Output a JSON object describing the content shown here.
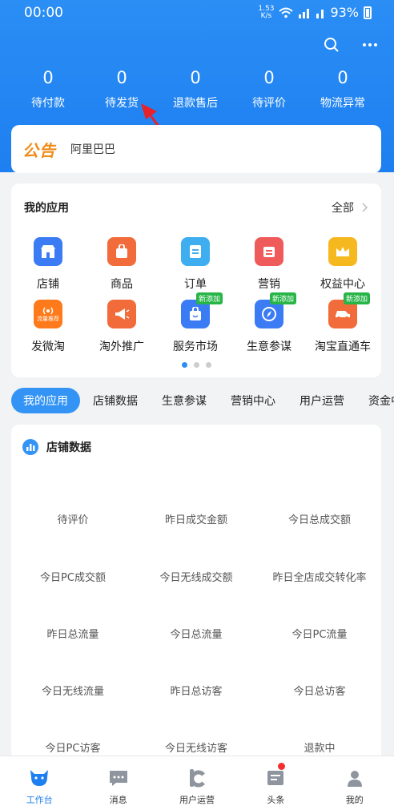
{
  "status": {
    "time": "00:00",
    "speed_value": "1.53",
    "speed_unit": "K/s",
    "battery": "93%"
  },
  "stats": [
    {
      "value": "0",
      "label": "待付款"
    },
    {
      "value": "0",
      "label": "待发货"
    },
    {
      "value": "0",
      "label": "退款售后"
    },
    {
      "value": "0",
      "label": "待评价"
    },
    {
      "value": "0",
      "label": "物流异常"
    }
  ],
  "notice": {
    "tag": "公告",
    "text": "阿里巴巴"
  },
  "apps": {
    "title": "我的应用",
    "all_label": "全部",
    "items": [
      {
        "label": "店铺",
        "color": "#3b7cf5",
        "icon": "shop-icon"
      },
      {
        "label": "商品",
        "color": "#f26b3a",
        "icon": "bag-icon"
      },
      {
        "label": "订单",
        "color": "#3eaef0",
        "icon": "order-icon"
      },
      {
        "label": "营销",
        "color": "#ef5a5a",
        "icon": "marketing-icon"
      },
      {
        "label": "权益中心",
        "color": "#f6b81f",
        "icon": "crown-icon"
      },
      {
        "label": "发微淘",
        "color": "#ff7a1a",
        "icon": "broadcast-icon",
        "inner": "流量推荐"
      },
      {
        "label": "淘外推广",
        "color": "#f26b3a",
        "icon": "megaphone-icon"
      },
      {
        "label": "服务市场",
        "color": "#3b7cf5",
        "icon": "market-bag-icon",
        "badge": "新添加"
      },
      {
        "label": "生意参谋",
        "color": "#3b7cf5",
        "icon": "compass-icon",
        "badge": "新添加"
      },
      {
        "label": "淘宝直通车",
        "color": "#f26b3a",
        "icon": "car-icon",
        "badge": "新添加"
      }
    ]
  },
  "tabs": [
    "我的应用",
    "店铺数据",
    "生意参谋",
    "营销中心",
    "用户运营",
    "资金中"
  ],
  "shop_data": {
    "title": "店铺数据",
    "rows": [
      [
        "待评价",
        "昨日成交金额",
        "今日总成交额"
      ],
      [
        "今日PC成交额",
        "今日无线成交额",
        "昨日全店成交转化率"
      ],
      [
        "昨日总流量",
        "今日总流量",
        "今日PC流量"
      ],
      [
        "今日无线流量",
        "昨日总访客",
        "今日总访客"
      ],
      [
        "今日PC访客",
        "今日无线访客",
        "退款中"
      ]
    ]
  },
  "tabbar": [
    {
      "label": "工作台",
      "icon": "cow-icon",
      "active": true
    },
    {
      "label": "消息",
      "icon": "message-icon"
    },
    {
      "label": "用户运营",
      "icon": "users-ops-icon"
    },
    {
      "label": "头条",
      "icon": "news-icon"
    },
    {
      "label": "我的",
      "icon": "profile-icon"
    }
  ],
  "colors": {
    "brand": "#1e7ff0",
    "notice": "#f08c1a",
    "badge": "#27b547"
  }
}
